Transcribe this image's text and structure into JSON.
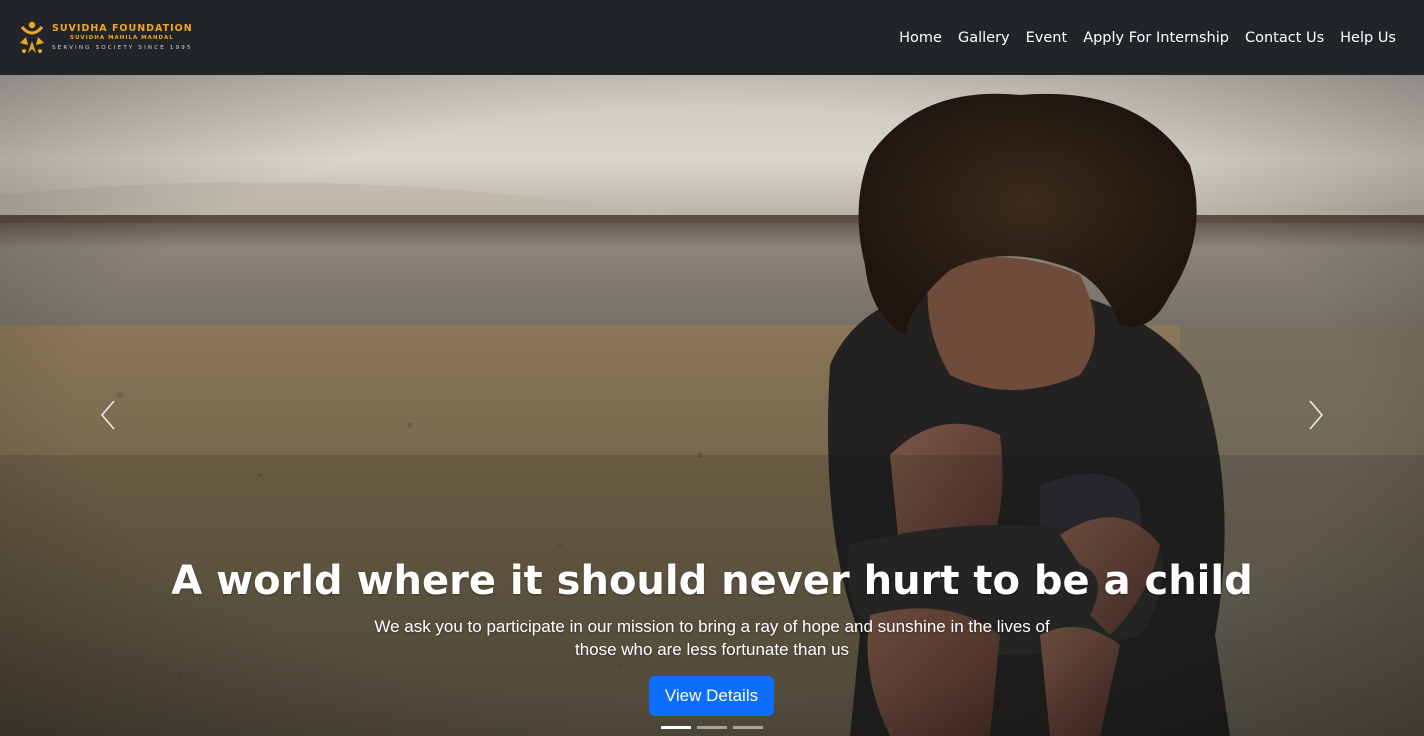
{
  "brand": {
    "name": "SUVIDHA FOUNDATION",
    "subtitle": "SUVIDHA MAHILA MANDAL",
    "tagline": "SERVING SOCIETY SINCE 1995",
    "accent_color": "#f0a81e"
  },
  "nav": {
    "items": [
      {
        "label": "Home"
      },
      {
        "label": "Gallery"
      },
      {
        "label": "Event"
      },
      {
        "label": "Apply For Internship"
      },
      {
        "label": "Contact Us"
      },
      {
        "label": "Help Us"
      }
    ]
  },
  "hero": {
    "title": "A world where it should never hurt to be a child",
    "text": "We ask you to participate in our mission to bring a ray of hope and sunshine in the lives of those who are less fortunate than us",
    "button_label": "View Details",
    "button_color": "#0d6efd",
    "slide_count": 3,
    "active_slide": 1,
    "prev_icon": "chevron-left-icon",
    "next_icon": "chevron-right-icon"
  }
}
